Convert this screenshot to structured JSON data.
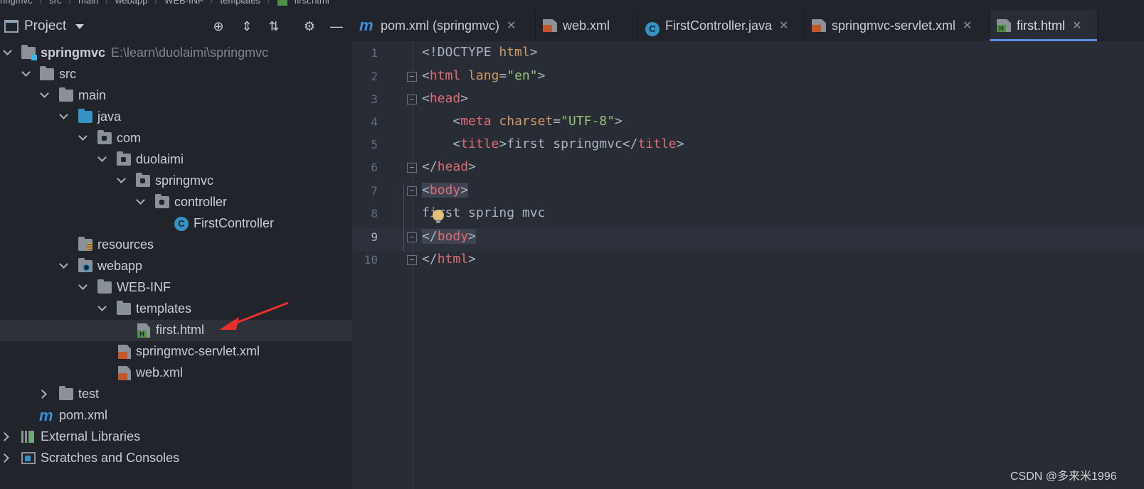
{
  "breadcrumb": [
    "ringmvc",
    "src",
    "main",
    "webapp",
    "WEB-INF",
    "templates",
    "first.html"
  ],
  "project_panel": {
    "title": "Project",
    "icons": [
      "crosshair-icon",
      "expand-all-icon",
      "collapse-all-icon",
      "gear-icon",
      "minimize-icon"
    ]
  },
  "tree": [
    {
      "label": "springmvc",
      "path": "E:\\learn\\duolaimi\\springmvc",
      "icon": "module-folder",
      "expanded": true
    },
    {
      "label": "src",
      "icon": "folder",
      "expanded": true
    },
    {
      "label": "main",
      "icon": "folder",
      "expanded": true
    },
    {
      "label": "java",
      "icon": "source-folder",
      "expanded": true
    },
    {
      "label": "com",
      "icon": "package",
      "expanded": true
    },
    {
      "label": "duolaimi",
      "icon": "package",
      "expanded": true
    },
    {
      "label": "springmvc",
      "icon": "package",
      "expanded": true
    },
    {
      "label": "controller",
      "icon": "package",
      "expanded": true
    },
    {
      "label": "FirstController",
      "icon": "java-class"
    },
    {
      "label": "resources",
      "icon": "resources-folder"
    },
    {
      "label": "webapp",
      "icon": "web-folder",
      "expanded": true
    },
    {
      "label": "WEB-INF",
      "icon": "folder",
      "expanded": true
    },
    {
      "label": "templates",
      "icon": "folder",
      "expanded": true
    },
    {
      "label": "first.html",
      "icon": "html-file",
      "selected": true
    },
    {
      "label": "springmvc-servlet.xml",
      "icon": "spring-xml-file"
    },
    {
      "label": "web.xml",
      "icon": "web-xml-file"
    },
    {
      "label": "test",
      "icon": "folder",
      "expanded": false
    },
    {
      "label": "pom.xml",
      "icon": "maven-file"
    },
    {
      "label": "External Libraries",
      "icon": "libraries",
      "expanded": false
    },
    {
      "label": "Scratches and Consoles",
      "icon": "scratches",
      "expanded": false
    }
  ],
  "tabs": [
    {
      "label": "pom.xml (springmvc)",
      "icon": "maven-icon"
    },
    {
      "label": "web.xml",
      "icon": "web-xml-icon"
    },
    {
      "label": "FirstController.java",
      "icon": "java-class-icon"
    },
    {
      "label": "springmvc-servlet.xml",
      "icon": "spring-xml-icon"
    },
    {
      "label": "first.html",
      "icon": "html-icon",
      "active": true
    }
  ],
  "editor": {
    "current_line": 9,
    "lines": [
      {
        "n": "1",
        "text": "<!DOCTYPE html>"
      },
      {
        "n": "2",
        "text": "<html lang=\"en\">"
      },
      {
        "n": "3",
        "text": "<head>"
      },
      {
        "n": "4",
        "text": "    <meta charset=\"UTF-8\">"
      },
      {
        "n": "5",
        "text": "    <title>first springmvc</title>"
      },
      {
        "n": "6",
        "text": "</head>"
      },
      {
        "n": "7",
        "text": "<body>"
      },
      {
        "n": "8",
        "text": "first spring mvc"
      },
      {
        "n": "9",
        "text": "</body>"
      },
      {
        "n": "10",
        "text": "</html>"
      }
    ]
  },
  "watermark": "CSDN @多来米1996",
  "colors": {
    "accent": "#5a8de6",
    "tag": "#e06c75",
    "attr": "#d19a66",
    "string": "#98c379",
    "arrow": "#e8302a"
  }
}
